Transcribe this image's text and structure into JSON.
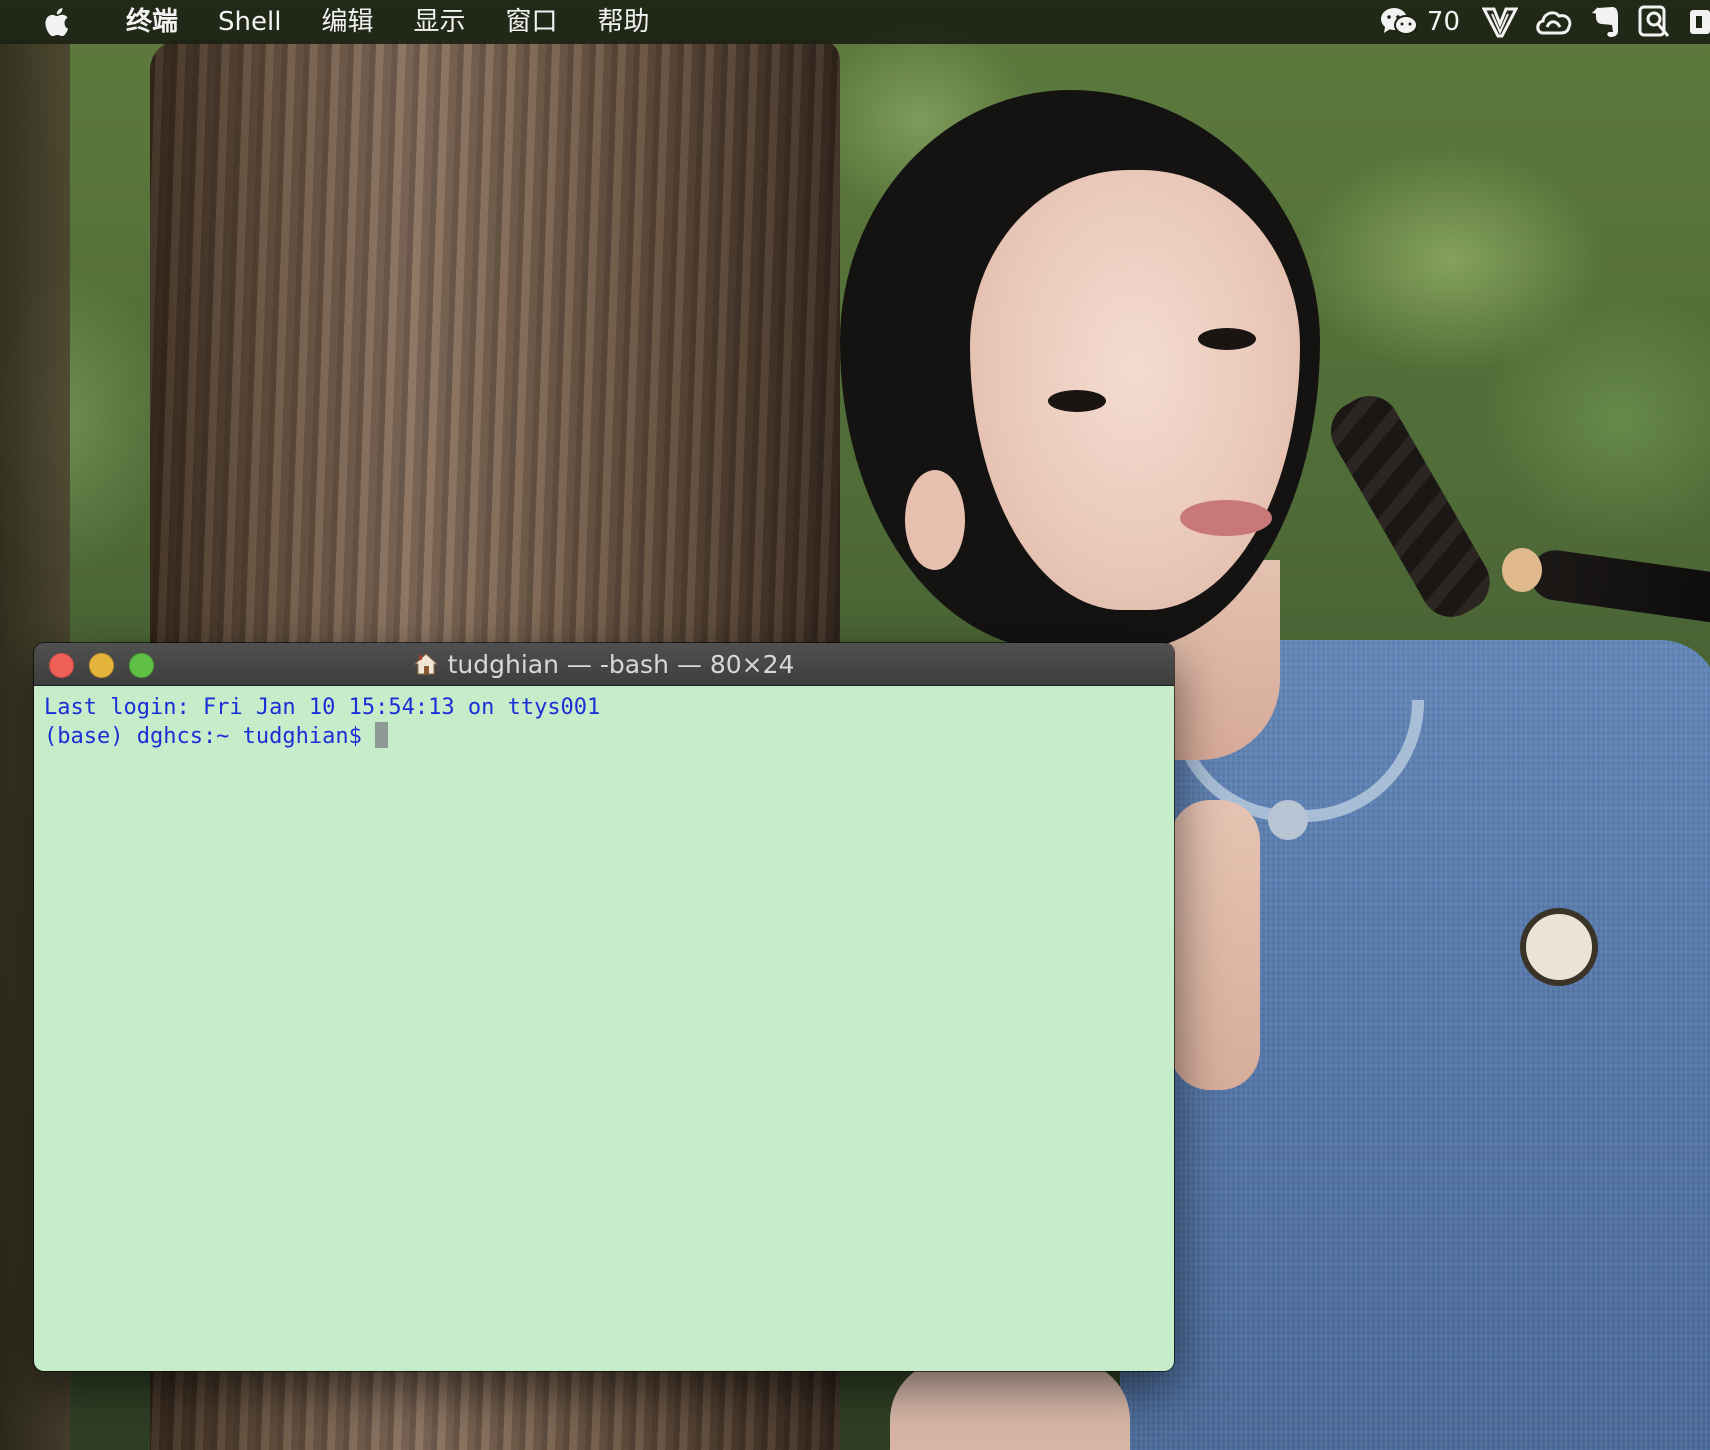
{
  "menubar": {
    "apple": "apple-logo",
    "items": [
      "终端",
      "Shell",
      "编辑",
      "显示",
      "窗口",
      "帮助"
    ],
    "status": {
      "wechat_count": "70"
    },
    "status_icons": [
      "wechat-icon",
      "vim-icon",
      "creative-cloud-icon",
      "evernote-icon",
      "search-app-icon",
      "app-icon"
    ]
  },
  "terminal": {
    "title": "tudghian — -bash — 80×24",
    "lines": [
      "Last login: Fri Jan 10 15:54:13 on ttys001",
      "(base) dghcs:~ tudghian$ "
    ],
    "colors": {
      "background": "#c6ecca",
      "text": "#1c2fd6",
      "cursor": "#8e9a94"
    }
  }
}
